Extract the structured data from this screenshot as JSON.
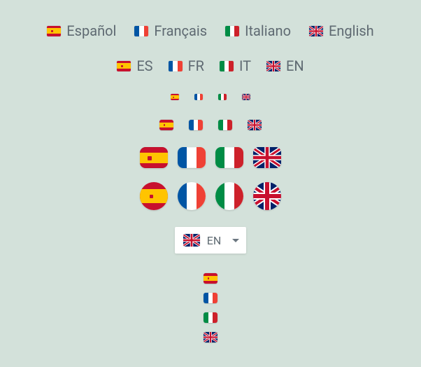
{
  "countries": {
    "es": {
      "label": "Español",
      "code": "ES",
      "name": "spain"
    },
    "fr": {
      "label": "Français",
      "code": "FR",
      "name": "france"
    },
    "it": {
      "label": "Italiano",
      "code": "IT",
      "name": "italy"
    },
    "gb": {
      "label": "English",
      "code": "EN",
      "name": "uk"
    }
  },
  "dropdown": {
    "selected_code": "EN",
    "selected_flag": "gb"
  }
}
